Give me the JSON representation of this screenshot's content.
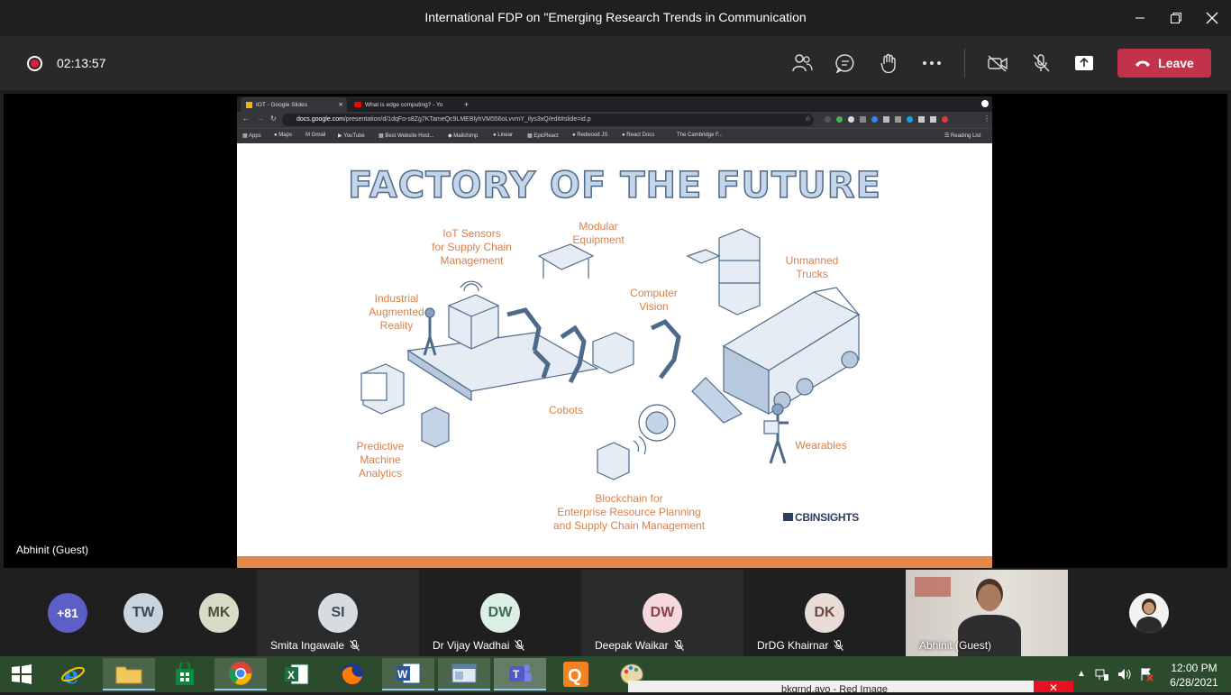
{
  "window": {
    "title": "International FDP on \"Emerging Research Trends in Communication",
    "minimize": "–",
    "restore": "❐",
    "close": "✕"
  },
  "meeting": {
    "timer": "02:13:57",
    "leave_label": "Leave",
    "presenter_label": "Abhinit (Guest)",
    "accent": "#c4314b"
  },
  "browser": {
    "tabs": [
      {
        "label": "IOT - Google Slides"
      },
      {
        "label": "What is edge computing? - Yo"
      }
    ],
    "new_tab": "+",
    "url_host": "docs.google.com",
    "url_path": "/presentation/d/1dqFo-s8Zg7KTameQc9LMEBlyhVM556oLvvmY_ilys3xQ/edit#slide=id.p",
    "bookmarks": [
      "Apps",
      "Maps",
      "Gmail",
      "YouTube",
      "Best Website Host...",
      "Mailchimp",
      "Linear",
      "EpicReact",
      "Redwood JS",
      "React Docs",
      "The Cambridge F..."
    ],
    "reading_list": "Reading List"
  },
  "slide": {
    "title": "FACTORY OF THE FUTURE",
    "labels": {
      "iot": [
        "IoT Sensors",
        "for Supply Chain",
        "Management"
      ],
      "modular": [
        "Modular",
        "Equipment"
      ],
      "unmanned": [
        "Unmanned",
        "Trucks"
      ],
      "industrial": [
        "Industrial",
        "Augmented",
        "Reality"
      ],
      "vision": [
        "Computer",
        "Vision"
      ],
      "cobots": [
        "Cobots"
      ],
      "predictive": [
        "Predictive",
        "Machine",
        "Analytics"
      ],
      "wearables": [
        "Wearables"
      ],
      "blockchain": [
        "Blockchain for",
        "Enterprise Resource Planning",
        "and Supply Chain Management"
      ]
    },
    "logo": "CBINSIGHTS"
  },
  "participants": [
    {
      "initials": "+81",
      "color": "#5b5fc7"
    },
    {
      "initials": "TW",
      "color": "#c9d5dc"
    },
    {
      "initials": "MK",
      "color": "#d8dcc6"
    },
    {
      "initials": "SI",
      "name": "Smita Ingawale",
      "color": "#d5dde3"
    },
    {
      "initials": "DW",
      "name": "Dr Vijay Wadhai",
      "color": "#dcefe5"
    },
    {
      "initials": "DW",
      "name": "Deepak Waikar",
      "color": "#f5d8dc"
    },
    {
      "initials": "DK",
      "name": "DrDG Khairnar",
      "color": "#e9dcd6"
    },
    {
      "name": "Abhinit (Guest)"
    }
  ],
  "taskbar": {
    "clock_time": "12:00 PM",
    "clock_date": "6/28/2021",
    "popup_text": "bkgrnd.avo - Red Image",
    "popup_close": "✕"
  }
}
